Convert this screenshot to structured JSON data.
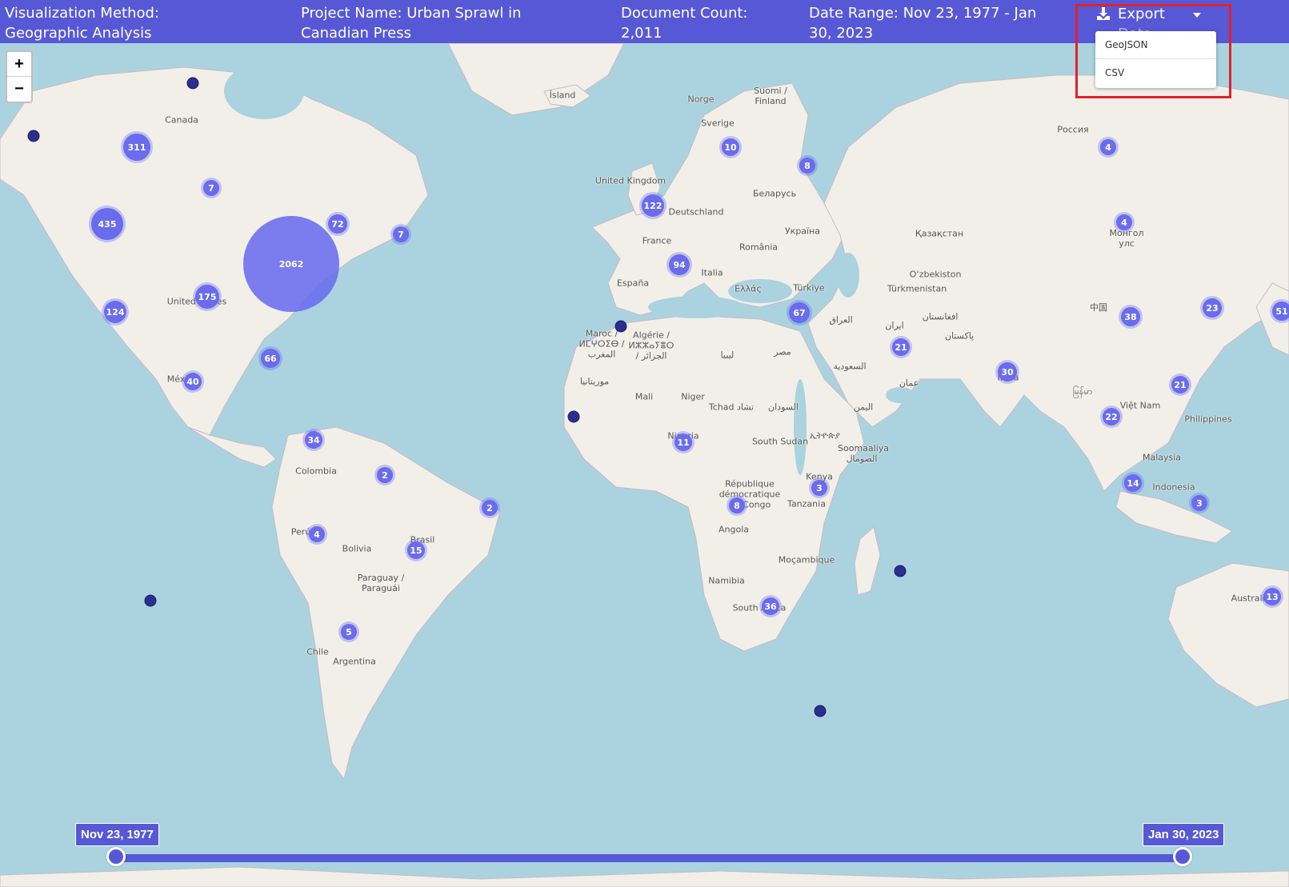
{
  "header": {
    "visualization_method": "Visualization Method: Geographic Analysis",
    "project_name": "Project Name: Urban Sprawl in Canadian Press",
    "document_count": "Document Count: 2,011",
    "date_range": "Date Range: Nov 23, 1977 - Jan 30, 2023",
    "export_label": "Export",
    "export_label_line2": "Data"
  },
  "export_menu": {
    "items": [
      "GeoJSON",
      "CSV"
    ]
  },
  "zoom": {
    "in": "+",
    "out": "−"
  },
  "places": [
    "Canada",
    "United States",
    "México",
    "Colombia",
    "Perú",
    "Bolivia",
    "Brasil",
    "Paraguay / Paraguái",
    "Chile",
    "Argentina",
    "Ísland",
    "Norge",
    "Sverige",
    "Suomi / Finland",
    "United Kingdom",
    "Deutschland",
    "France",
    "España",
    "Italia",
    "Беларусь",
    "Україна",
    "România",
    "Ελλάς",
    "Türkiye",
    "Maroc / ⵍⵎⵖⵔⵉⴱ / المغرب",
    "Algérie / ⵍⵣⵣⴰⵢⴻⵔ / الجزائر",
    "ليبيا",
    "مصر",
    "موريتانيا",
    "Mali",
    "Niger",
    "Tchad تشاد",
    "السودان",
    "Nigeria",
    "South Sudan",
    "ኢትዮጵያ",
    "Soomaaliya الصومال",
    "Kenya",
    "République démocratique du Congo",
    "Tanzania",
    "Angola",
    "Namibia",
    "Moçambique",
    "South Africa",
    "Россия",
    "Қазақстан",
    "Монгол улс",
    "O‘zbekiston",
    "Türkmenistan",
    "العراق",
    "ایران",
    "السعودية",
    "افغانستان",
    "پاکستان",
    "عمان",
    "اليمن",
    "India",
    "中国",
    "မြန်မာ",
    "Việt Nam",
    "Philippines",
    "Malaysia",
    "Indonesia",
    "Australia"
  ],
  "clusters": [
    "311",
    "7",
    "435",
    "72",
    "7",
    "2062",
    "175",
    "124",
    "66",
    "40",
    "34",
    "2",
    "2",
    "4",
    "15",
    "5",
    "10",
    "8",
    "122",
    "94",
    "67",
    "21",
    "11",
    "8",
    "3",
    "36",
    "4",
    "4",
    "38",
    "23",
    "51",
    "30",
    "21",
    "22",
    "14",
    "3",
    "13"
  ],
  "slider": {
    "start_label": "Nov 23, 1977",
    "end_label": "Jan 30, 2023",
    "start_value": 0,
    "end_value": 1
  },
  "colors": {
    "header": "#5758d6",
    "cluster": "#6a6cee",
    "point": "#2b2e8c",
    "water": "#aad3df",
    "land": "#f2efe9",
    "highlight": "#e3202a"
  }
}
